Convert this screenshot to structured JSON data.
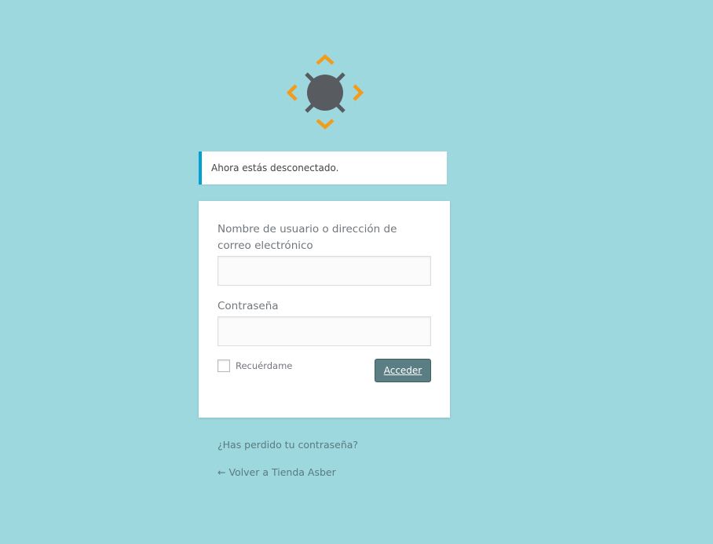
{
  "notice": {
    "message": "Ahora estás desconectado."
  },
  "login_form": {
    "username_label": "Nombre de usuario o dirección de correo electrónico",
    "username_value": "",
    "password_label": "Contraseña",
    "password_value": "",
    "remember_label": "Recuérdame",
    "remember_checked": false,
    "submit_label": "Acceder"
  },
  "links": {
    "lost_password": "¿Has perdido tu contraseña?",
    "back_to_site": "← Volver a Tienda Asber"
  },
  "colors": {
    "background": "#9dd8df",
    "notice_border": "#00a0d2",
    "submit_button": "#5a7e84",
    "logo_orange": "#f39c1b",
    "logo_gray": "#585b5f"
  },
  "icons": {
    "logo": "site-logo-icon"
  }
}
